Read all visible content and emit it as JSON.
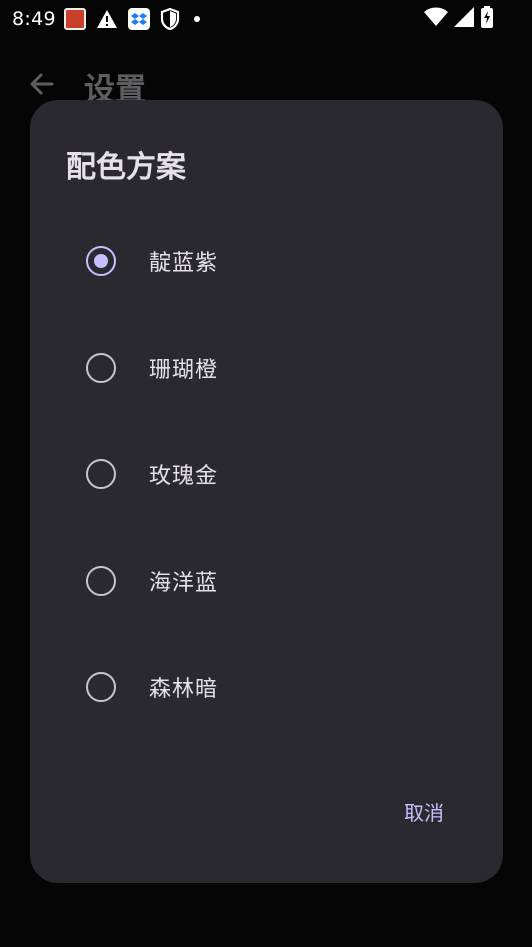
{
  "status_bar": {
    "time": "8:49",
    "icons": [
      "app-notification-icon",
      "warning-icon",
      "dropbox-icon",
      "shield-icon",
      "dot-icon",
      "wifi-icon",
      "signal-icon",
      "battery-charging-icon"
    ]
  },
  "app_bar": {
    "title": "设置"
  },
  "dialog": {
    "title": "配色方案",
    "options": [
      {
        "label": "靛蓝紫",
        "selected": true
      },
      {
        "label": "珊瑚橙",
        "selected": false
      },
      {
        "label": "玫瑰金",
        "selected": false
      },
      {
        "label": "海洋蓝",
        "selected": false
      },
      {
        "label": "森林暗",
        "selected": false
      }
    ],
    "cancel_label": "取消"
  },
  "colors": {
    "dialog_bg": "#2a292f",
    "accent": "#c5c0ff",
    "text": "#e6e1e9",
    "background": "#050506"
  }
}
